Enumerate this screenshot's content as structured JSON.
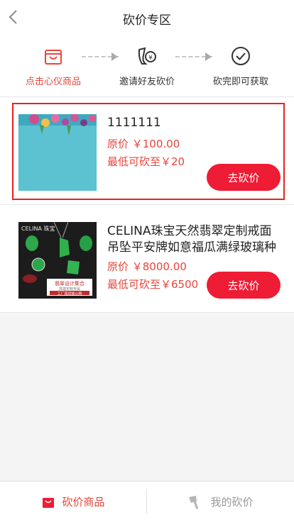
{
  "header": {
    "title": "砍价专区",
    "back_icon": "chevron-left-icon"
  },
  "steps": [
    {
      "label": "点击心仪商品",
      "icon": "shopping-bag-icon",
      "active": true
    },
    {
      "label": "邀请好友砍价",
      "icon": "share-friends-icon",
      "active": false
    },
    {
      "label": "砍完即可获取",
      "icon": "check-circle-icon",
      "active": false
    }
  ],
  "items": [
    {
      "name": "1111111",
      "price": "原价 ￥100.00",
      "min_price": "最低可砍至￥20",
      "button": "去砍价",
      "selected": true
    },
    {
      "name": "CELINA珠宝天然翡翠定制戒面吊坠平安牌如意福瓜满绿玻璃种",
      "price": "原价 ￥8000.00",
      "min_price": "最低可砍至￥6500",
      "button": "去砍价",
      "selected": false,
      "image_text": {
        "brand": "CELINA 珠宝",
        "caption": "翡翠设计集合",
        "sub1": "高端定制专属",
        "sub2": "工厂直供放心购"
      }
    }
  ],
  "tabbar": {
    "tabs": [
      {
        "label": "砍价商品",
        "icon": "shopping-bag-icon",
        "active": true
      },
      {
        "label": "我的砍价",
        "icon": "axe-icon",
        "active": false
      }
    ]
  },
  "colors": {
    "accent": "#ee1c34",
    "accent_text": "#e8453c",
    "highlight_border": "#e6221d"
  }
}
